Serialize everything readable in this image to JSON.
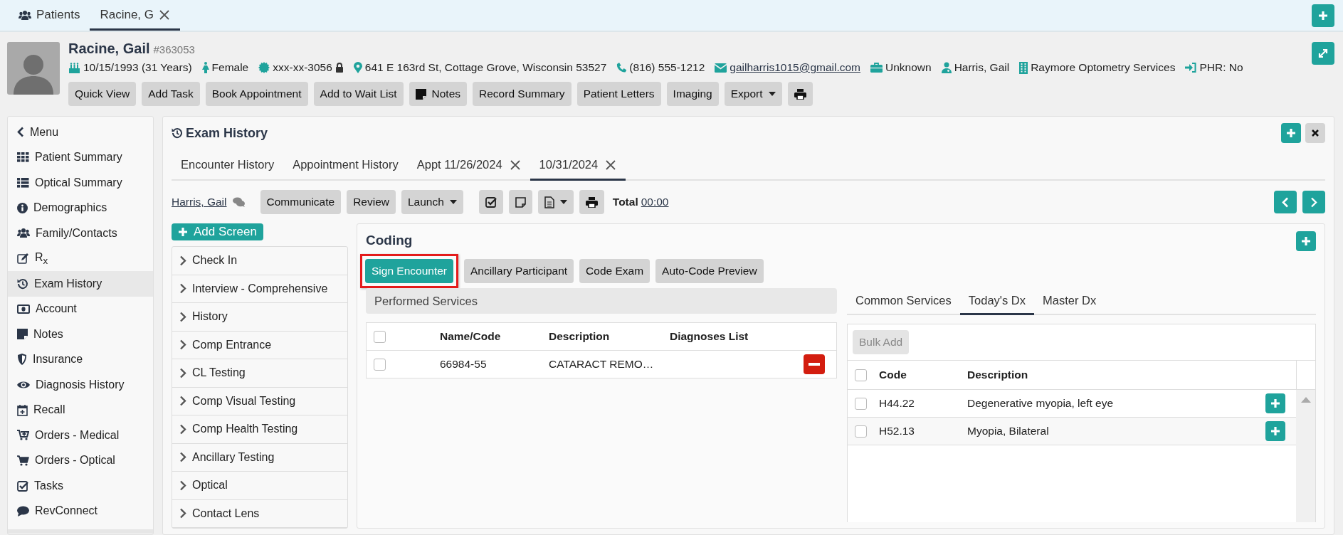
{
  "top_tabs": [
    {
      "label": "Patients",
      "closable": false,
      "selected": false
    },
    {
      "label": "Racine, G",
      "closable": true,
      "selected": true
    }
  ],
  "patient": {
    "name": "Racine, Gail",
    "id": "#363053",
    "details": [
      {
        "kind": "dob",
        "text": "10/15/1993 (31 Years)"
      },
      {
        "kind": "gender",
        "text": "Female"
      },
      {
        "kind": "ssn",
        "text": "xxx-xx-3056"
      },
      {
        "kind": "address",
        "text": "641 E 163rd St, Cottage Grove, Wisconsin 53527"
      },
      {
        "kind": "phone",
        "text": "(816) 555-1212"
      },
      {
        "kind": "email",
        "text": "gailharris1015@gmail.com"
      },
      {
        "kind": "employer",
        "text": "Unknown"
      },
      {
        "kind": "provider",
        "text": "Harris, Gail"
      },
      {
        "kind": "location",
        "text": "Raymore Optometry Services"
      },
      {
        "kind": "phr",
        "text": "PHR: No"
      }
    ],
    "actions": [
      {
        "kind": "text",
        "label": "Quick View"
      },
      {
        "kind": "text",
        "label": "Add Task"
      },
      {
        "kind": "text",
        "label": "Book Appointment"
      },
      {
        "kind": "text",
        "label": "Add to Wait List"
      },
      {
        "kind": "notes",
        "label": "Notes"
      },
      {
        "kind": "text",
        "label": "Record Summary"
      },
      {
        "kind": "text",
        "label": "Patient Letters"
      },
      {
        "kind": "text",
        "label": "Imaging"
      },
      {
        "kind": "dropdown",
        "label": "Export"
      },
      {
        "kind": "print"
      }
    ]
  },
  "sidebar": {
    "items": [
      {
        "label": "Menu",
        "selected": false
      },
      {
        "label": "Patient Summary",
        "selected": false
      },
      {
        "label": "Optical Summary",
        "selected": false
      },
      {
        "label": "Demographics",
        "selected": false
      },
      {
        "label": "Family/Contacts",
        "selected": false
      },
      {
        "label": "R$_{x}$",
        "selected": false
      },
      {
        "label": "Exam History",
        "selected": true
      },
      {
        "label": "Account",
        "selected": false
      },
      {
        "label": "Notes",
        "selected": false
      },
      {
        "label": "Insurance",
        "selected": false
      },
      {
        "label": "Diagnosis History",
        "selected": false
      },
      {
        "label": "Recall",
        "selected": false
      },
      {
        "label": "Orders - Medical",
        "selected": false
      },
      {
        "label": "Orders - Optical",
        "selected": false
      },
      {
        "label": "Tasks",
        "selected": false
      },
      {
        "label": "RevConnect",
        "selected": false
      }
    ]
  },
  "exam_history": {
    "title": "Exam History",
    "tabs": [
      {
        "label": "Encounter History",
        "closable": false,
        "selected": false
      },
      {
        "label": "Appointment History",
        "closable": false,
        "selected": false
      },
      {
        "label": "Appt 11/26/2024",
        "closable": true,
        "selected": false
      },
      {
        "label": "10/31/2024",
        "closable": true,
        "selected": true
      }
    ],
    "toolbar": {
      "provider": "Harris, Gail",
      "buttons": [
        {
          "kind": "text",
          "label": "Communicate"
        },
        {
          "kind": "text",
          "label": "Review"
        },
        {
          "kind": "dropdown",
          "label": "Launch"
        },
        {
          "kind": "checkbox-icon"
        },
        {
          "kind": "note-icon"
        },
        {
          "kind": "file-dropdown"
        },
        {
          "kind": "print"
        }
      ],
      "total_label": "Total",
      "total_value": "00:00"
    },
    "add_screen": "Add Screen",
    "screens": [
      "Check In",
      "Interview - Comprehensive",
      "History",
      "Comp Entrance",
      "CL Testing",
      "Comp Visual Testing",
      "Comp Health Testing",
      "Ancillary Testing",
      "Optical",
      "Contact Lens"
    ],
    "coding": {
      "title": "Coding",
      "buttons": [
        {
          "label": "Sign Encounter",
          "primary": true,
          "highlighted": true
        },
        {
          "label": "Ancillary Participant",
          "primary": false,
          "highlighted": false
        },
        {
          "label": "Code Exam",
          "primary": false,
          "highlighted": false
        },
        {
          "label": "Auto-Code Preview",
          "primary": false,
          "highlighted": false
        }
      ],
      "performed_services": {
        "title": "Performed Services",
        "all_checked": false,
        "columns": [
          "Name/Code",
          "Description",
          "Diagnoses List"
        ],
        "rows": [
          {
            "checked": false,
            "code": "66984-55",
            "description": "CATARACT REMO…"
          }
        ]
      },
      "dx_tabs": [
        {
          "label": "Common Services",
          "selected": false
        },
        {
          "label": "Today's Dx",
          "selected": true
        },
        {
          "label": "Master Dx",
          "selected": false
        }
      ],
      "bulk_add": {
        "label": "Bulk Add",
        "disabled": true
      },
      "dx_table": {
        "all_checked": false,
        "columns": [
          "Code",
          "Description"
        ],
        "rows": [
          {
            "checked": false,
            "code": "H44.22",
            "description": "Degenerative myopia, left eye"
          },
          {
            "checked": false,
            "code": "H52.13",
            "description": "Myopia, Bilateral"
          }
        ]
      }
    }
  }
}
